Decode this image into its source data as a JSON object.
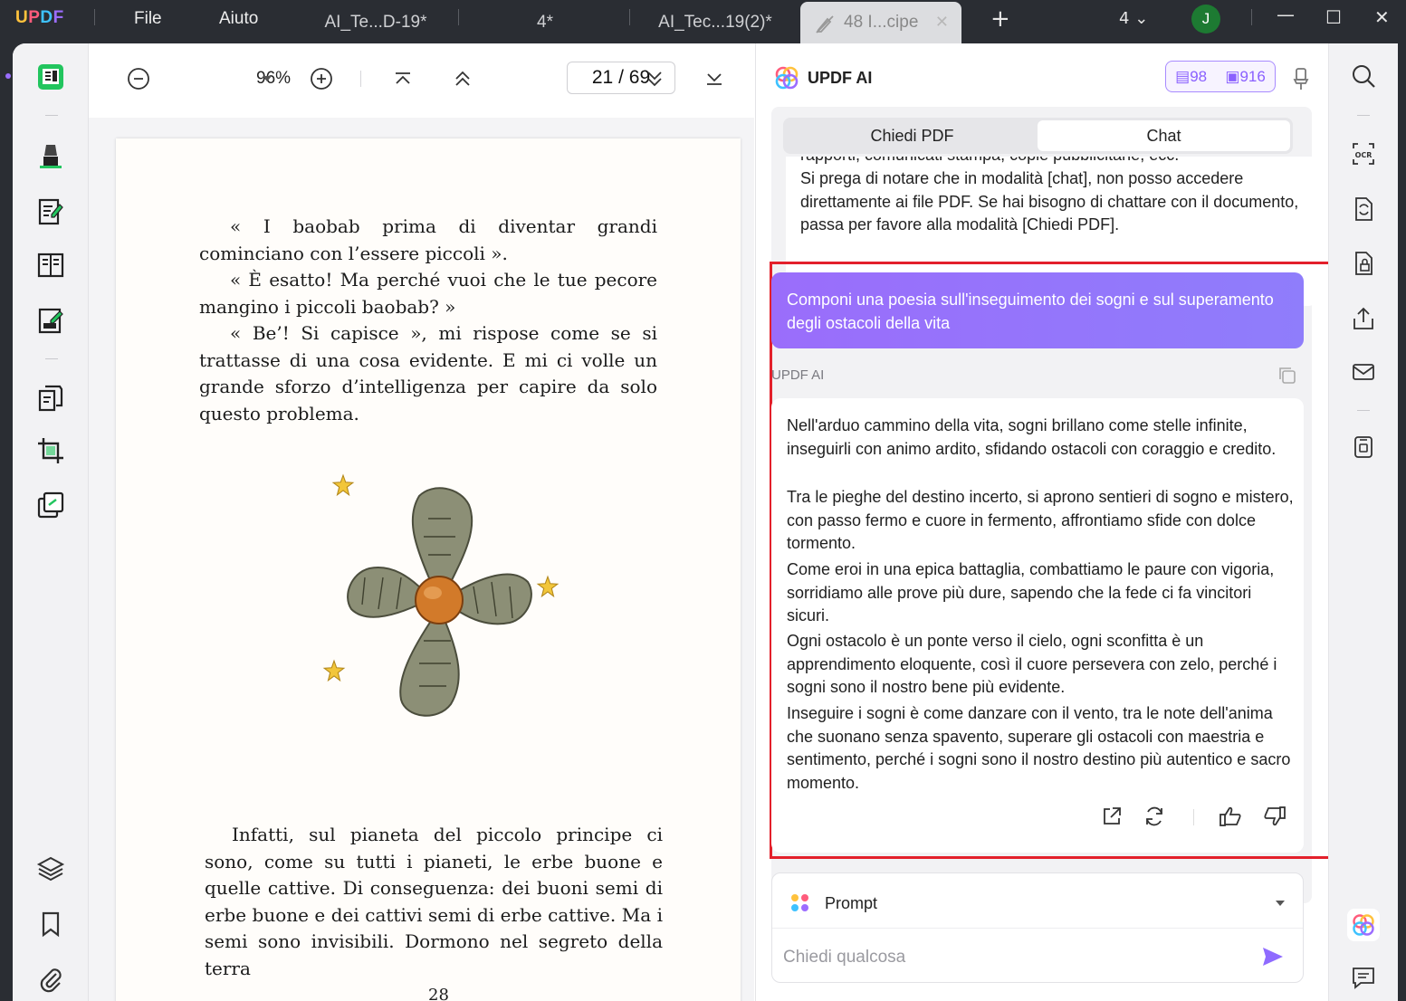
{
  "app": {
    "logo": [
      "U",
      "P",
      "D",
      "F"
    ],
    "menu": [
      "File",
      "Aiuto"
    ],
    "tabs": [
      {
        "label": "AI_Te...D-19*",
        "active": false
      },
      {
        "label": "4*",
        "active": false
      },
      {
        "label": "AI_Tec...19(2)*",
        "active": false
      },
      {
        "label": "48 I...cipe",
        "active": true
      }
    ],
    "tab_count": "4",
    "user_initial": "J",
    "colors": {
      "accent": "#8f6bff",
      "highlight": "#e3202b",
      "avatar": "#1d7a32"
    }
  },
  "toolbar": {
    "zoom": "96%",
    "page_current": "21",
    "page_sep": "/",
    "page_total": "69"
  },
  "pdf": {
    "para1": "« I baobab prima di diventar grandi cominciano con l’essere piccoli ».",
    "para2": "« È esatto! Ma perché vuoi che le tue pecore mangino i piccoli baobab? »",
    "para3": "« Be’! Si capisce », mi rispose come se si trattasse di una cosa evidente. E mi ci volle un grande sforzo d’intelligenza per capire da solo questo problema.",
    "para4": "Infatti, sul pianeta del piccolo principe ci sono, come su tutti i pianeti, le erbe buone e quelle cattive. Di conseguenza: dei buoni semi di erbe buone e dei cattivi semi di erbe cattive. Ma i semi sono invisibili. Dormono nel segreto della terra",
    "page_number": "28"
  },
  "ai": {
    "title": "UPDF AI",
    "credits_docs": "98",
    "credits_chat": "916",
    "tabs": [
      "Chiedi PDF",
      "Chat"
    ],
    "active_tab": "Chat",
    "prev_line_cut": "rapporti, comunicati stampa, copie pubblicitarie, ecc.",
    "prev_message": "Si prega di notare che in modalità [chat], non posso accedere direttamente ai file PDF. Se hai bisogno di chattare con il documento, passa per favore alla modalità [Chiedi PDF].",
    "user_message": "Componi una poesia sull'inseguimento dei sogni e sul superamento degli ostacoli della vita",
    "ai_label": "UPDF AI",
    "response": [
      "Nell'arduo cammino della vita, sogni brillano come stelle infinite, inseguirli con animo ardito, sfidando ostacoli con coraggio e credito.",
      "Tra le pieghe del destino incerto, si aprono sentieri di sogno e mistero, con passo fermo e cuore in fermento, affrontiamo sfide con dolce tormento.",
      "Come eroi in una epica battaglia, combattiamo le paure con vigoria, sorridiamo alle prove più dure, sapendo che la fede ci fa vincitori sicuri.",
      "Ogni ostacolo è un ponte verso il cielo, ogni sconfitta è un apprendimento eloquente, così il cuore persevera con zelo, perché i sogni sono il nostro bene più evidente.",
      "Inseguire i sogni è come danzare con il vento, tra le note dell'anima che suonano senza spavento, superare gli ostacoli con maestria e sentimento, perché i sogni sono il nostro destino più autentico e sacro momento."
    ],
    "prompt_label": "Prompt",
    "input_placeholder": "Chiedi qualcosa"
  }
}
